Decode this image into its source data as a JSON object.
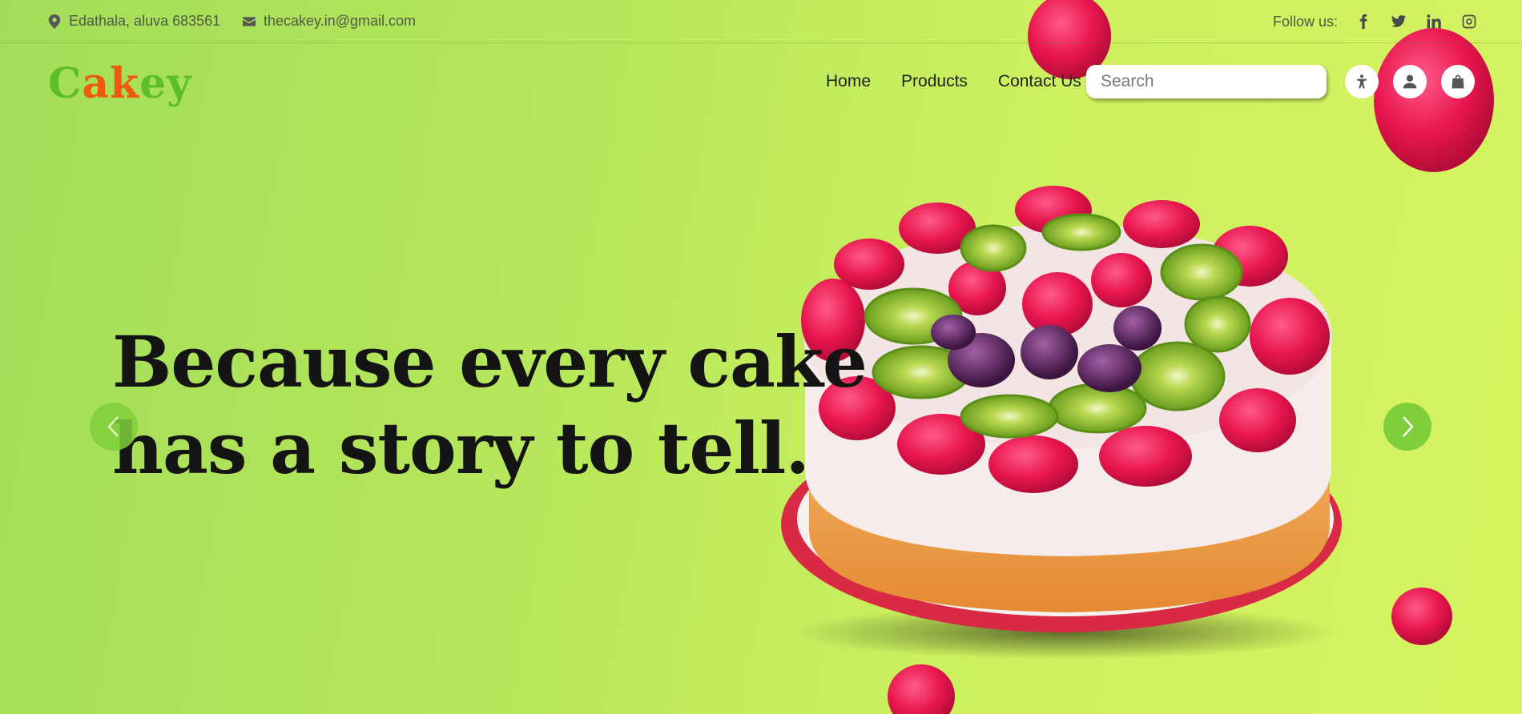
{
  "topbar": {
    "address": "Edathala, aluva 683561",
    "email": "thecakey.in@gmail.com",
    "follow_label": "Follow us:",
    "social_icons": [
      "facebook-icon",
      "twitter-icon",
      "linkedin-icon",
      "instagram-icon"
    ]
  },
  "logo": {
    "letters": [
      "C",
      "a",
      "k",
      "e",
      "y"
    ],
    "colors": [
      "#5cbf2a",
      "#f05a0c",
      "#f05a0c",
      "#5cbf2a",
      "#5cbf2a"
    ]
  },
  "nav": {
    "items": [
      "Home",
      "Products",
      "Contact Us"
    ]
  },
  "search": {
    "placeholder": "Search"
  },
  "hero": {
    "line1": "Because every cake",
    "line2": "has a story to tell."
  },
  "colors": {
    "accent_green": "#7fcf3a",
    "background_start": "#a3dd58",
    "background_end": "#d6f460"
  }
}
